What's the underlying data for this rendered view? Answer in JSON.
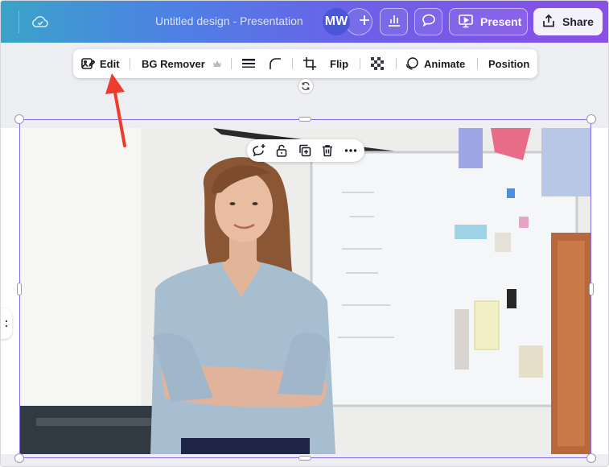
{
  "header": {
    "title": "Untitled design - Presentation",
    "avatar_initials": "MW",
    "present_label": "Present",
    "share_label": "Share",
    "icons": [
      "cloud-saved-icon",
      "plus-icon",
      "bar-chart-icon",
      "comment-icon",
      "present-icon",
      "share-icon"
    ]
  },
  "toolbar": {
    "edit_label": "Edit",
    "bg_remover_label": "BG Remover",
    "flip_label": "Flip",
    "animate_label": "Animate",
    "position_label": "Position",
    "icons": [
      "edit-image-icon",
      "crown-icon",
      "border-style-icon",
      "corner-rounding-icon",
      "crop-icon",
      "transparency-icon",
      "animate-icon"
    ]
  },
  "element_toolbar": {
    "icons": [
      "add-comment-icon",
      "lock-icon",
      "duplicate-icon",
      "delete-icon",
      "more-icon"
    ]
  },
  "colors": {
    "accent": "#8b6ee6",
    "annotation_arrow": "#ee3b2f",
    "share_bg": "#f3f1fb"
  }
}
